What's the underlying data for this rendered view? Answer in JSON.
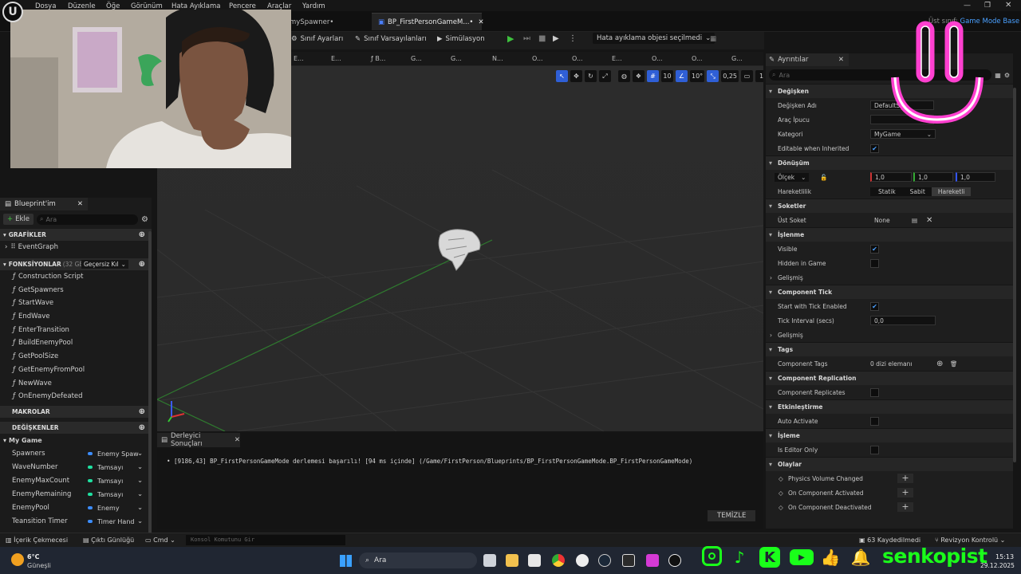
{
  "menu": [
    "Dosya",
    "Düzenle",
    "Öğe",
    "Görünüm",
    "Hata Ayıklama",
    "Pencere",
    "Araçlar",
    "Yardım"
  ],
  "tabs": {
    "first": "mySpawner•",
    "active": "BP_FirstPersonGameM...•",
    "parent_label": "Üst sınıf:",
    "parent_value": "Game Mode Base"
  },
  "toolbar": {
    "class_settings": "Sınıf Ayarları",
    "class_defaults": "Sınıf Varsayılanları",
    "simulation": "Simülasyon",
    "debug_select": "Hata ayıklama objesi seçilmedi"
  },
  "breadcrumbs": [
    "E...",
    "E...",
    "B...",
    "G...",
    "G...",
    "N...",
    "O...",
    "O...",
    "E...",
    "O...",
    "O...",
    "G..."
  ],
  "viewport": {
    "grid": "10",
    "angle": "10°",
    "scale": "0,25",
    "cams": "1"
  },
  "blueprint": {
    "title": "Blueprint'im",
    "add": "Ekle",
    "search_placeholder": "Ara",
    "graphs_label": "GRAFİKLER",
    "event_graph": "EventGraph",
    "functions_label": "FONKSİYONLAR",
    "functions_count": "(32 GEÇE",
    "override": "Geçersiz Kıl",
    "functions": [
      "Construction Script",
      "GetSpawners",
      "StartWave",
      "EndWave",
      "EnterTransition",
      "BuildEnemyPool",
      "GetPoolSize",
      "GetEnemyFromPool",
      "NewWave",
      "OnEnemyDefeated"
    ],
    "macros_label": "MAKROLAR",
    "variables_label": "DEĞİŞKENLER",
    "category": "My Game",
    "variables": [
      {
        "name": "Spawners",
        "type": "Enemy Spaw",
        "color": "#3c8dff"
      },
      {
        "name": "WaveNumber",
        "type": "Tamsayı",
        "color": "#1fe0a0"
      },
      {
        "name": "EnemyMaxCount",
        "type": "Tamsayı",
        "color": "#1fe0a0"
      },
      {
        "name": "EnemyRemaining",
        "type": "Tamsayı",
        "color": "#1fe0a0"
      },
      {
        "name": "EnemyPool",
        "type": "Enemy",
        "color": "#3c8dff"
      },
      {
        "name": "Teansition Timer",
        "type": "Timer Hand",
        "color": "#3c8dff"
      }
    ]
  },
  "compiler": {
    "tab": "Derleyici Sonuçları",
    "message": "[9186,43] BP_FirstPersonGameMode derlemesi başarılı! [94 ms içinde] (/Game/FirstPerson/Blueprints/BP_FirstPersonGameMode.BP_FirstPersonGameMode)",
    "clear": "TEMİZLE"
  },
  "details": {
    "title": "Ayrıntılar",
    "search_placeholder": "Ara",
    "sec_variable": "Değişken",
    "var_name_label": "Değişken Adı",
    "var_name_value": "DefaultSc",
    "tooltip_label": "Araç İpucu",
    "category_label": "Kategori",
    "category_value": "MyGame",
    "editable_label": "Editable when Inherited",
    "sec_transform": "Dönüşüm",
    "scale_label": "Ölçek",
    "scale_x": "1,0",
    "scale_y": "1,0",
    "scale_z": "1,0",
    "mobility_label": "Hareketlilik",
    "mob_static": "Statik",
    "mob_stationary": "Sabit",
    "mob_movable": "Hareketli",
    "sec_sockets": "Soketler",
    "parent_socket_label": "Üst Soket",
    "parent_socket_value": "None",
    "sec_render": "İşlenme",
    "visible_label": "Visible",
    "hidden_label": "Hidden in Game",
    "advanced": "Gelişmiş",
    "sec_tick": "Component Tick",
    "tick_start_label": "Start with Tick Enabled",
    "tick_interval_label": "Tick Interval (secs)",
    "tick_interval_value": "0,0",
    "sec_tags": "Tags",
    "tags_label": "Component Tags",
    "tags_value": "0 dizi elemanı",
    "sec_replication": "Component Replication",
    "replicates_label": "Component Replicates",
    "sec_activation": "Etkinleştirme",
    "auto_activate_label": "Auto Activate",
    "sec_cooking": "İşleme",
    "editor_only_label": "Is Editor Only",
    "sec_events": "Olaylar",
    "ev1": "Physics Volume Changed",
    "ev2": "On Component Activated",
    "ev3": "On Component Deactivated"
  },
  "status": {
    "content_drawer": "İçerik Çekmecesi",
    "output_log": "Çıktı Günlüğü",
    "cmd": "Cmd",
    "console_placeholder": "Konsol Komutunu Gir",
    "saved": "63 Kaydedilmedi",
    "revision": "Revizyon Kontrolü"
  },
  "taskbar": {
    "temp": "6°C",
    "weather": "Güneşli",
    "search": "Ara",
    "time": "15:13",
    "date": "29.12.2025"
  },
  "overlay": {
    "channel": "senkopist"
  }
}
